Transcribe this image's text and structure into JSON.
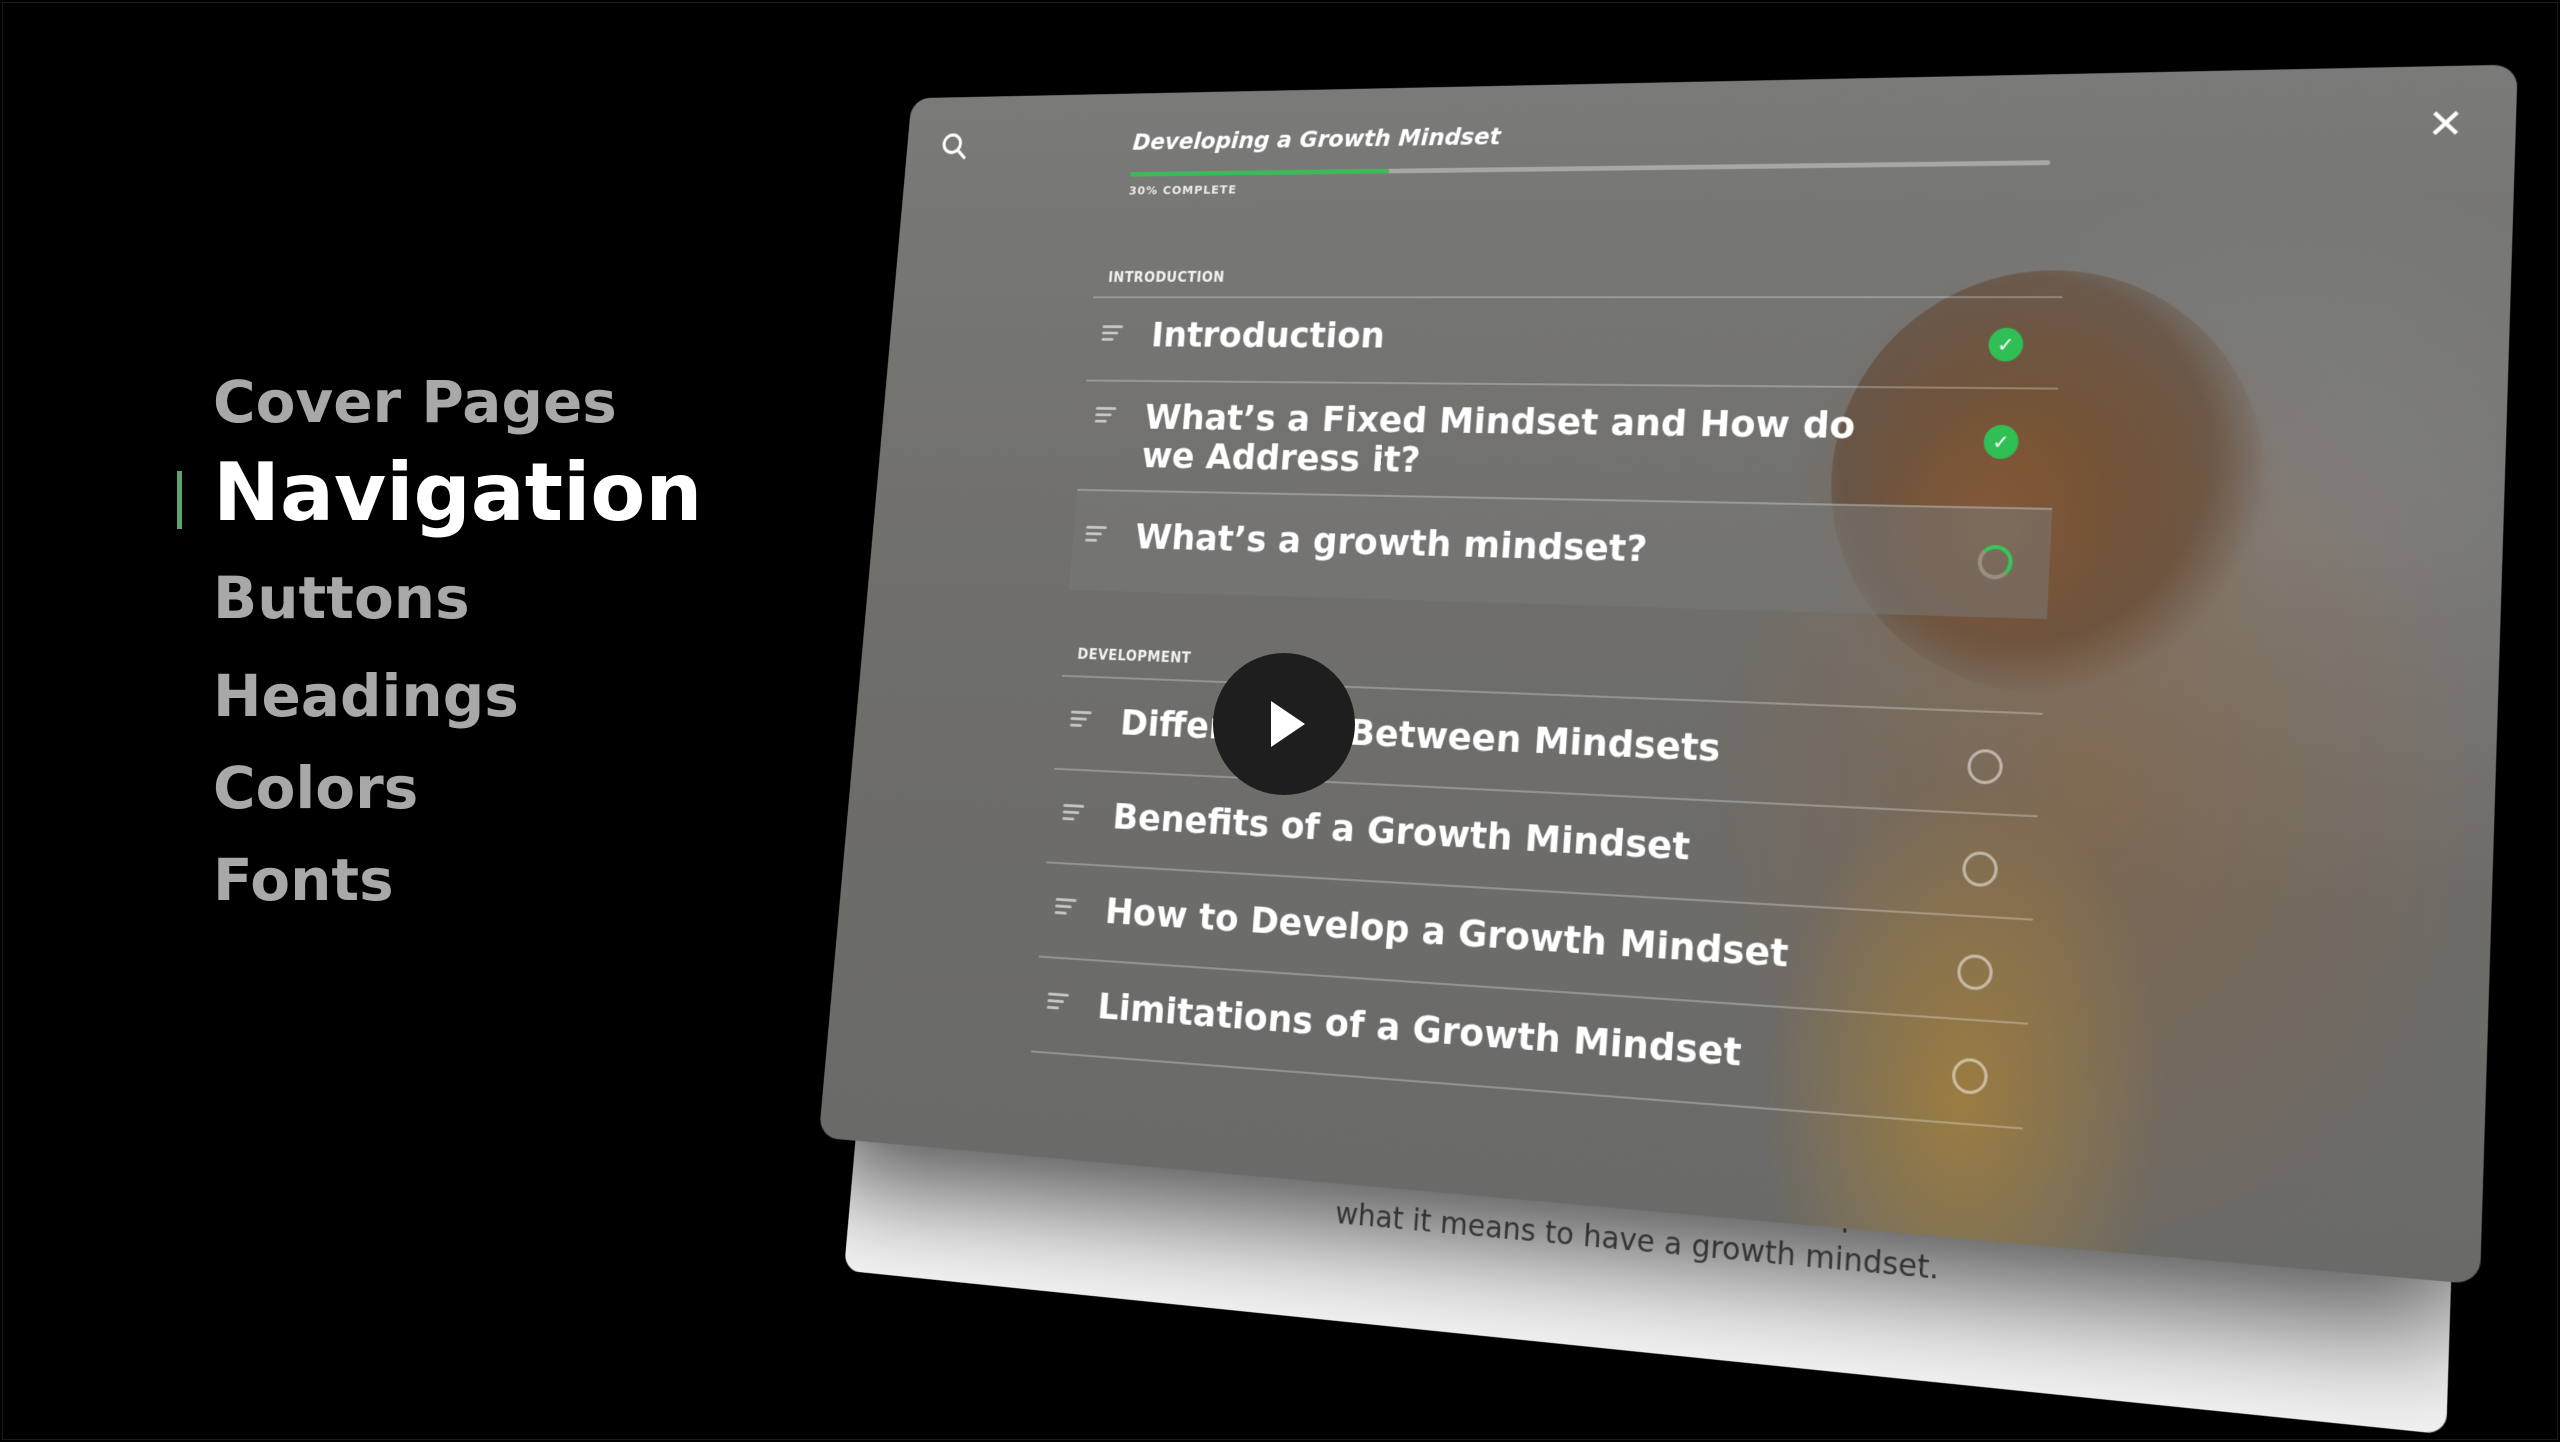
{
  "side_menu": {
    "items": [
      {
        "label": "Cover Pages"
      },
      {
        "label": "Navigation"
      },
      {
        "label": "Buttons"
      },
      {
        "label": "Headings"
      },
      {
        "label": "Colors"
      },
      {
        "label": "Fonts"
      }
    ],
    "active_index": 1,
    "accent_color": "#5aa56b"
  },
  "course": {
    "title": "Developing a Growth Mindset",
    "progress_label": "30% COMPLETE",
    "progress_fraction": 0.3,
    "progress_color": "#3cba5a"
  },
  "sections": [
    {
      "label": "INTRODUCTION",
      "lessons": [
        {
          "title": "Introduction",
          "status": "complete"
        },
        {
          "title": "What’s a Fixed Mindset and How do we Address it?",
          "status": "complete"
        },
        {
          "title": "What’s a growth mindset?",
          "status": "in-progress"
        }
      ]
    },
    {
      "label": "DEVELOPMENT",
      "lessons": [
        {
          "title": "Differences Between Mindsets",
          "status": "not-started"
        },
        {
          "title": "Benefits of a Growth Mindset",
          "status": "not-started"
        },
        {
          "title": "How to Develop a Growth Mindset",
          "status": "not-started"
        },
        {
          "title": "Limitations of a Growth Mindset",
          "status": "not-started"
        }
      ]
    }
  ],
  "back_card": {
    "caption": "Continue to the next lesson to explore what it means to have a growth mindset."
  },
  "icons": {
    "search": "search-icon",
    "close": "close-icon",
    "play": "play-icon",
    "drag": "drag-handle-icon",
    "check": "check-icon"
  }
}
